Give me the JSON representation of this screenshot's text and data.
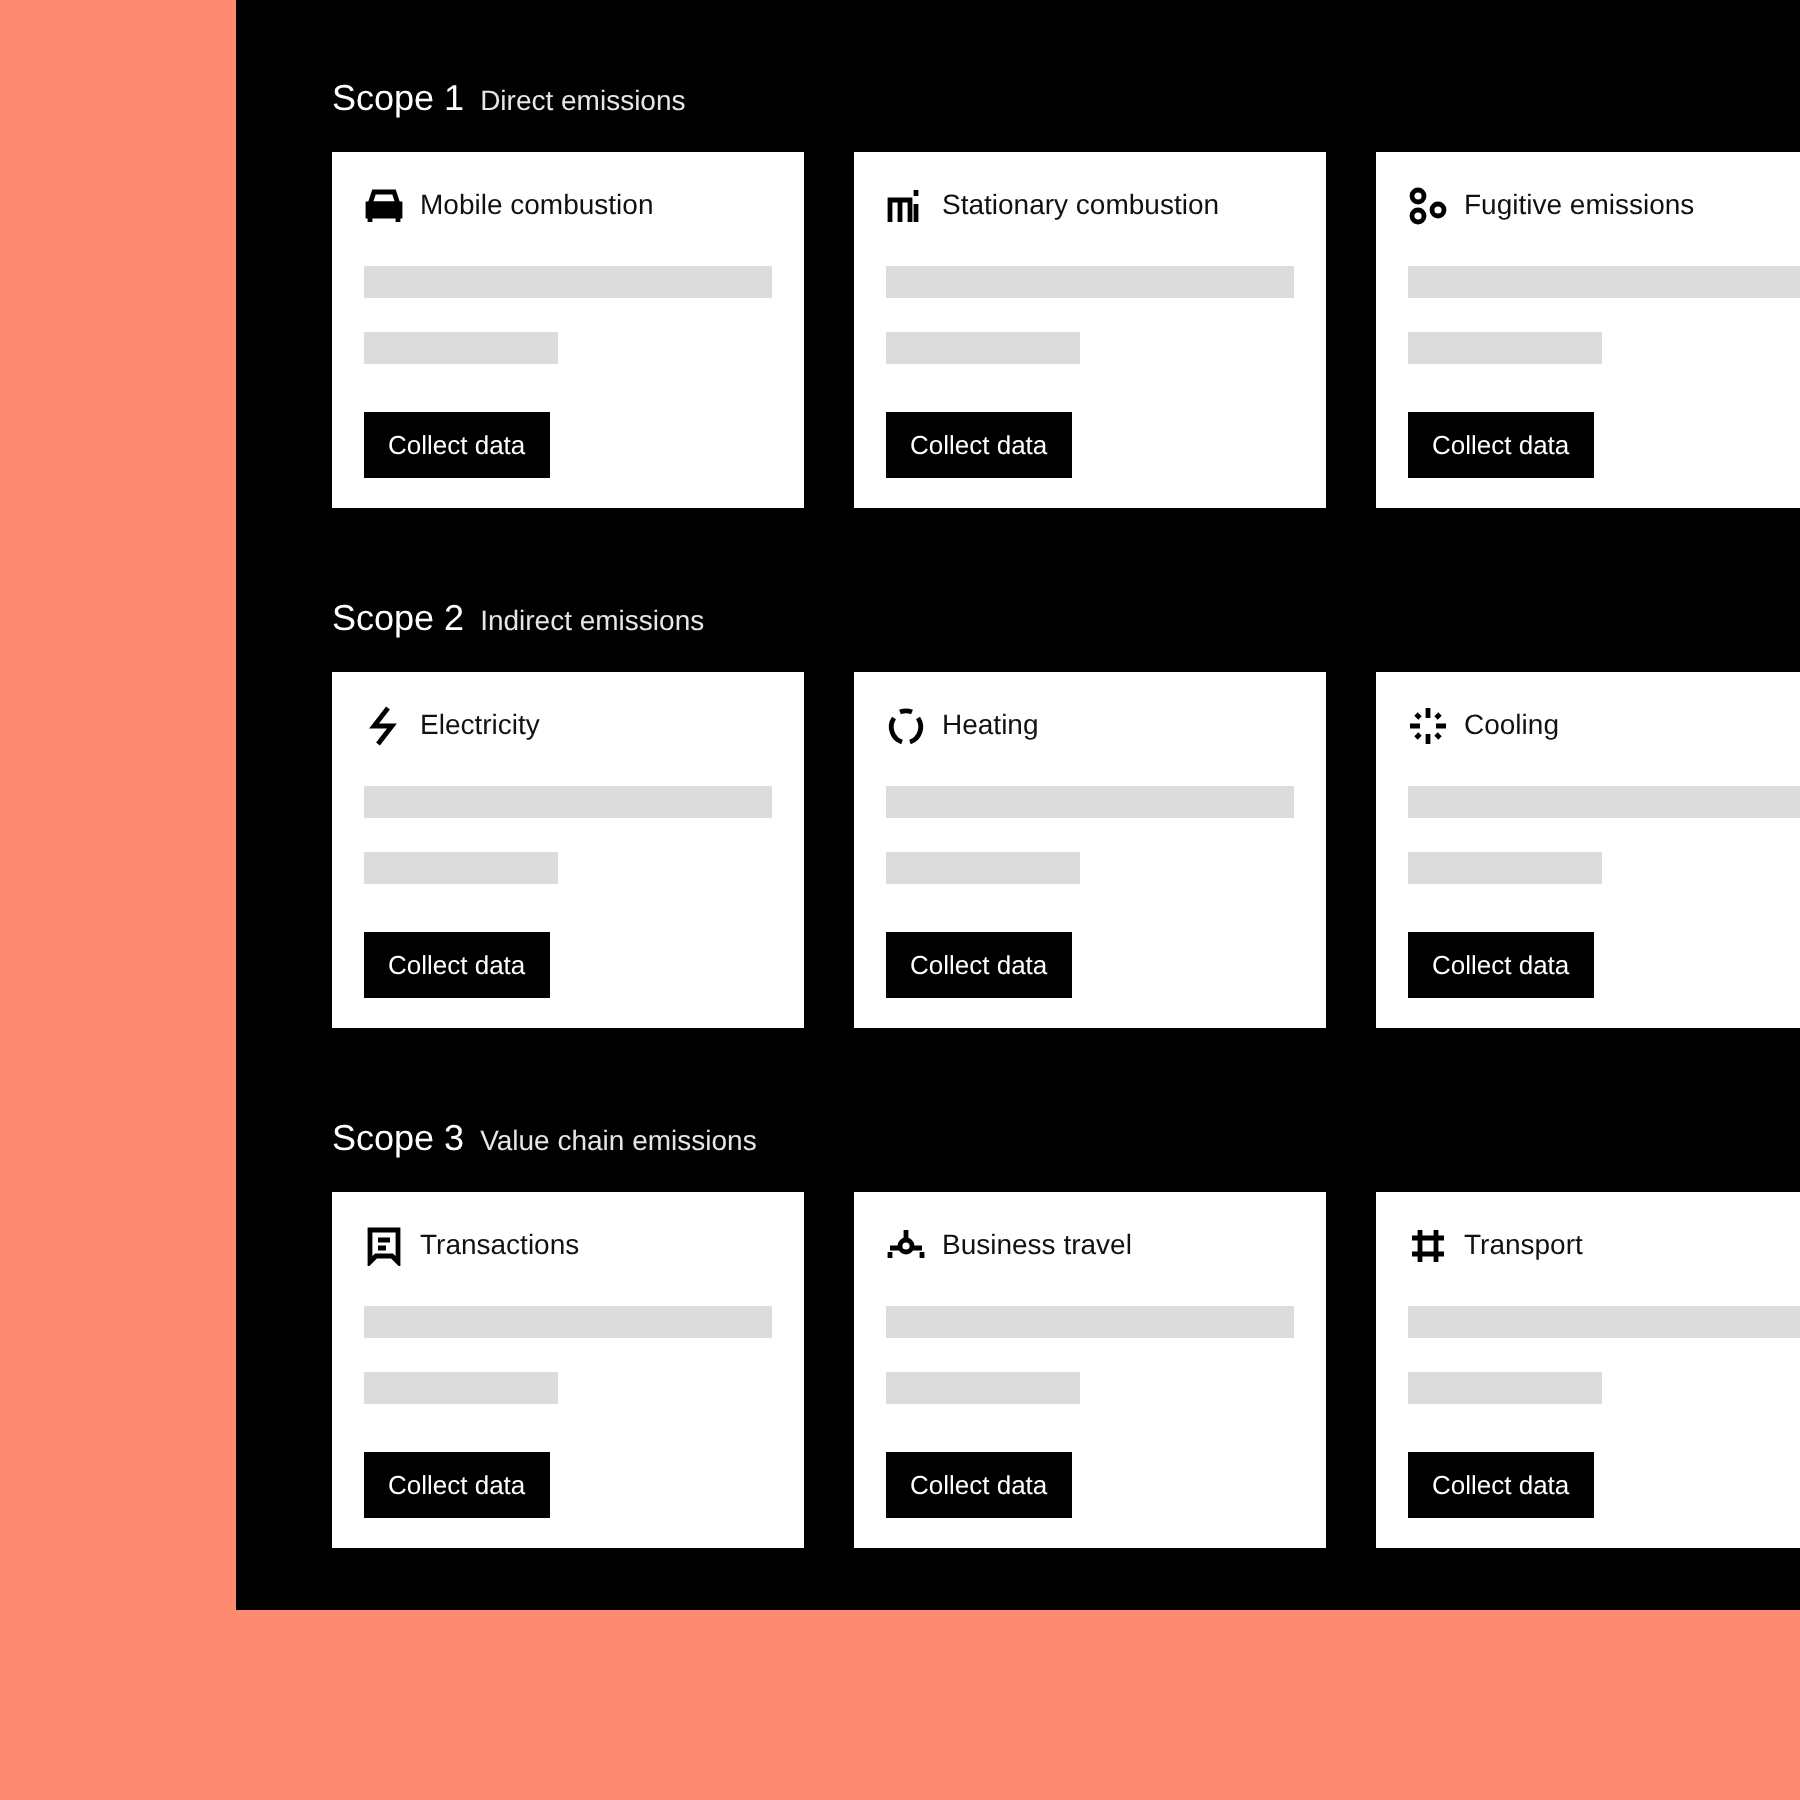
{
  "sections": [
    {
      "title": "Scope 1",
      "subtitle": "Direct emissions",
      "cards": [
        {
          "label": "Mobile combustion",
          "button": "Collect data"
        },
        {
          "label": "Stationary combustion",
          "button": "Collect data"
        },
        {
          "label": "Fugitive emissions",
          "button": "Collect data"
        }
      ]
    },
    {
      "title": "Scope 2",
      "subtitle": "Indirect emissions",
      "cards": [
        {
          "label": "Electricity",
          "button": "Collect data"
        },
        {
          "label": "Heating",
          "button": "Collect data"
        },
        {
          "label": "Cooling",
          "button": "Collect data"
        }
      ]
    },
    {
      "title": "Scope 3",
      "subtitle": "Value chain emissions",
      "cards": [
        {
          "label": "Transactions",
          "button": "Collect data"
        },
        {
          "label": "Business travel",
          "button": "Collect data"
        },
        {
          "label": "Transport",
          "button": "Collect data"
        }
      ]
    }
  ]
}
